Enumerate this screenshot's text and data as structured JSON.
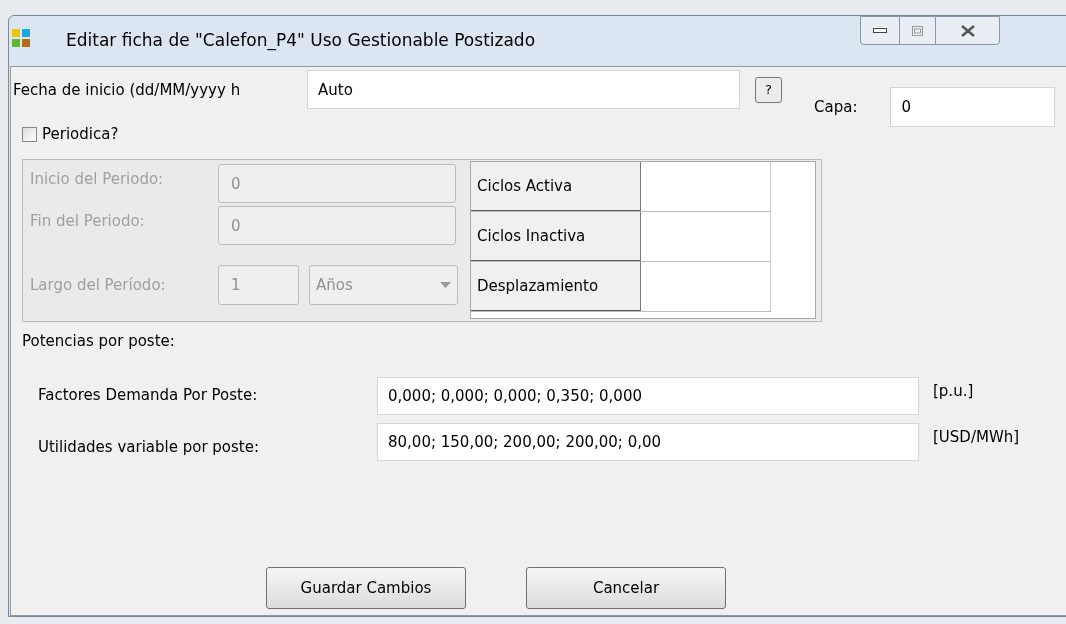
{
  "window": {
    "title": "Editar ficha de  \"Calefon_P4\" Uso Gestionable Postizado"
  },
  "fecha": {
    "label": "Fecha de inicio (dd/MM/yyyy h",
    "value": "Auto",
    "help_button": "?"
  },
  "capa": {
    "label": "Capa:",
    "value": "0"
  },
  "periodica": {
    "label": "Periodica?",
    "checked": false
  },
  "periodo": {
    "disabled": true,
    "inicio": {
      "label": "Inicio del Periodo:",
      "value": "0"
    },
    "fin": {
      "label": "Fin del Periodo:",
      "value": "0"
    },
    "largo": {
      "label": "Largo del Período:",
      "value": "1",
      "unit": "Años"
    }
  },
  "ciclos_table": {
    "rows": [
      "Ciclos Activa",
      "Ciclos Inactiva",
      "Desplazamiento"
    ]
  },
  "potencias_label": "Potencias por poste:",
  "poste_fields": [
    {
      "label": "Factores Demanda Por Poste:",
      "value": "0,000; 0,000; 0,000; 0,350; 0,000",
      "unit": "[p.u.]"
    },
    {
      "label": "Utilidades variable por poste:",
      "value": "80,00; 150,00; 200,00; 200,00; 0,00",
      "unit": "[USD/MWh]"
    }
  ],
  "buttons": [
    "Guardar Cambios",
    "Cancelar"
  ]
}
